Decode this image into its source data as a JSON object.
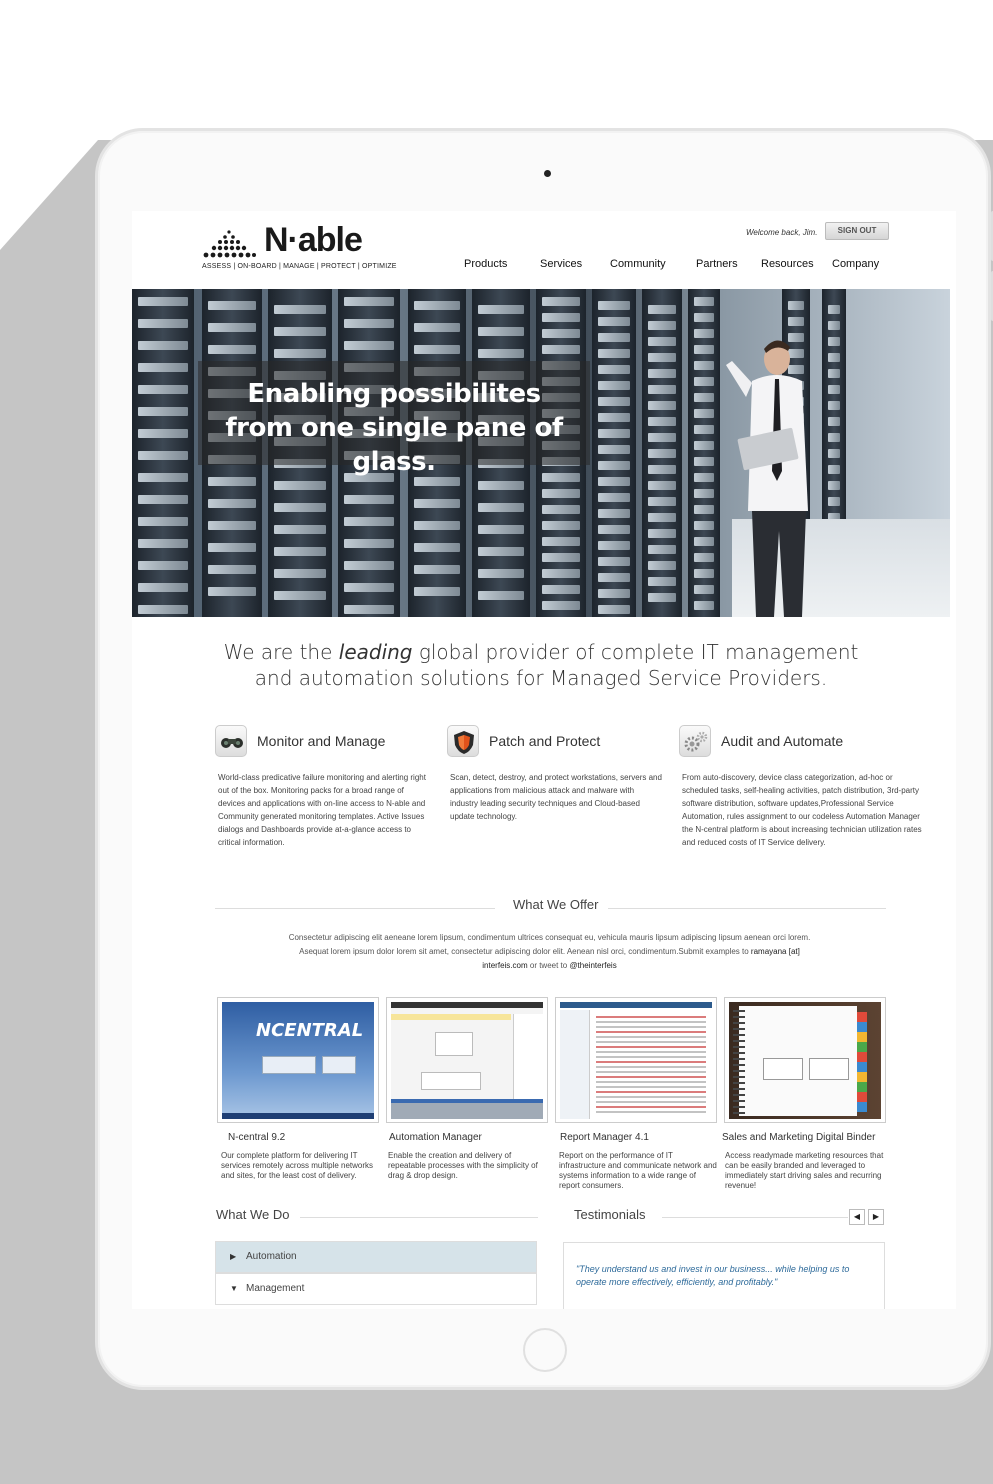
{
  "header": {
    "logo_text": "N·able",
    "logo_tagline": "ASSESS | ON-BOARD | MANAGE | PROTECT | OPTIMIZE",
    "welcome": "Welcome back, Jim.",
    "signout": "SIGN OUT"
  },
  "nav": [
    "Products",
    "Services",
    "Community",
    "Partners",
    "Resources",
    "Company"
  ],
  "hero": {
    "line1": "Enabling possibilites",
    "line2": "from one single pane of glass."
  },
  "lead": {
    "pre": "We are the ",
    "em": "leading",
    "post": " global provider of complete IT management",
    "line2": "and automation solutions for Managed Service Providers."
  },
  "features": [
    {
      "title": "Monitor and Manage",
      "icon": "binoculars-icon",
      "body": "World-class predicative failure monitoring and alerting right out of the box. Monitoring packs for a broad range of devices and applications with on-line access to N-able and Community generated monitoring templates. Active Issues dialogs and Dashboards provide at-a-glance access to critical information."
    },
    {
      "title": "Patch and Protect",
      "icon": "shield-icon",
      "body": "Scan, detect, destroy, and protect workstations, servers and applications from malicious attack and malware with industry leading security techniques and Cloud-based update technology."
    },
    {
      "title": "Audit and Automate",
      "icon": "gears-icon",
      "body": "From auto-discovery, device class categorization, ad-hoc or scheduled tasks, self-healing activities, patch distribution, 3rd-party software distribution, software updates,Professional Service Automation, rules assignment to our codeless Automation Manager the N-central platform is about increasing technician utilization rates and reduced costs of IT Service delivery."
    }
  ],
  "offer": {
    "title": "What We Offer",
    "text1": "Consectetur adipiscing elit aeneane lorem lipsum, condimentum ultrices consequat eu, vehicula mauris lipsum adipiscing lipsum aenean orci lorem. Asequat lorem ipsum dolor lorem sit amet, consectetur adipiscing dolor elit. Aenean nisl orci, condimentum.Submit examples to ",
    "email": "ramayana [at] interfeis.com",
    "text2": " or tweet to ",
    "twitter": "@theinterfeis"
  },
  "products": [
    {
      "title": "N-central 9.2",
      "body": "Our complete platform for delivering IT services remotely across multiple networks and sites, for the least cost of delivery.",
      "shot_label": "NCENTRAL"
    },
    {
      "title": "Automation Manager",
      "body": "Enable the creation and delivery of repeatable processes with the simplicity of drag & drop design."
    },
    {
      "title": "Report Manager 4.1",
      "body": "Report on the performance of IT infrastructure and communicate network and systems information to a wide range of report consumers."
    },
    {
      "title": "Sales and Marketing Digital Binder",
      "body": "Access readymade marketing resources that can be easily branded and leveraged to immediately start driving sales and recurring revenue!"
    }
  ],
  "what_we_do": {
    "title": "What We Do",
    "items": [
      "Automation",
      "Management"
    ]
  },
  "testimonials": {
    "title": "Testimonials",
    "quote": "\"They understand us and invest in our business... while helping us to operate more effectively, efficiently, and profitably.\"",
    "prev": "◀",
    "next": "▶"
  }
}
